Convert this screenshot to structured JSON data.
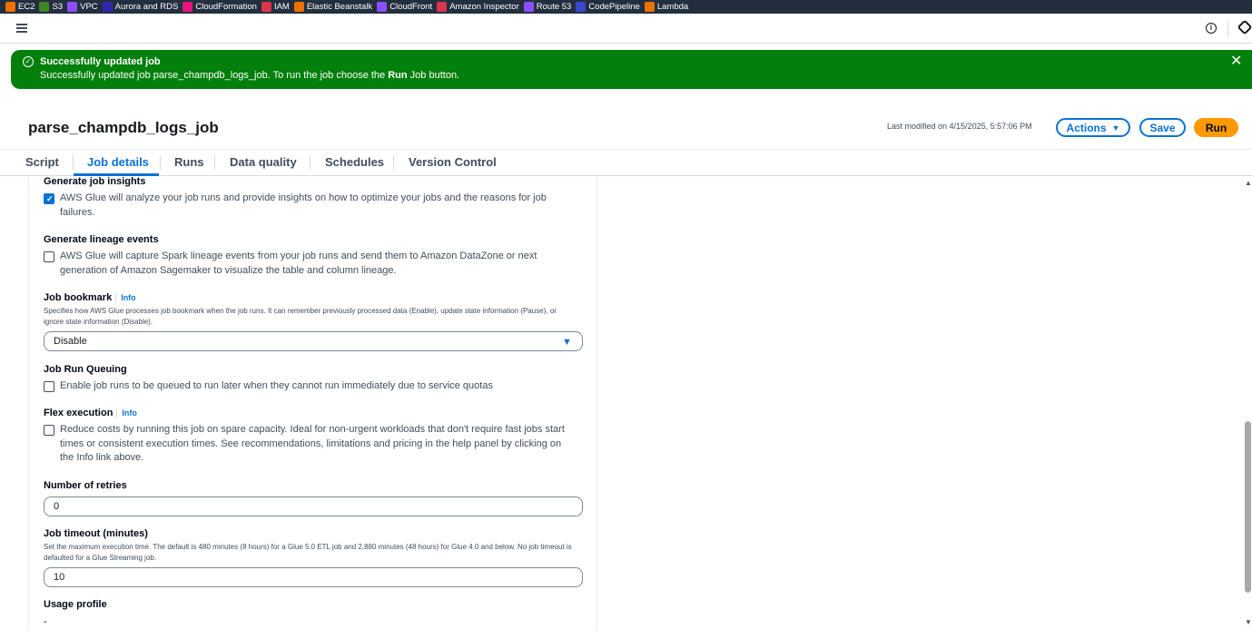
{
  "favorites": [
    {
      "label": "EC2",
      "color": "#ed7100"
    },
    {
      "label": "S3",
      "color": "#3f8624"
    },
    {
      "label": "VPC",
      "color": "#8c4fff"
    },
    {
      "label": "Aurora and RDS",
      "color": "#2e27ad"
    },
    {
      "label": "CloudFormation",
      "color": "#e7157b"
    },
    {
      "label": "IAM",
      "color": "#dd344c"
    },
    {
      "label": "Elastic Beanstalk",
      "color": "#ed7100"
    },
    {
      "label": "CloudFront",
      "color": "#8c4fff"
    },
    {
      "label": "Amazon Inspector",
      "color": "#dd344c"
    },
    {
      "label": "Route 53",
      "color": "#8c4fff"
    },
    {
      "label": "CodePipeline",
      "color": "#3b48cc"
    },
    {
      "label": "Lambda",
      "color": "#ed7100"
    }
  ],
  "flash": {
    "title": "Successfully updated job",
    "message_before": "Successfully updated job parse_champdb_logs_job. To run the job choose the ",
    "message_bold": "Run",
    "message_after": " Job button.",
    "color": "#037f0c"
  },
  "header": {
    "title": "parse_champdb_logs_job",
    "last_modified": "Last modified on 4/15/2025, 5:57:06 PM",
    "actions_label": "Actions",
    "save_label": "Save",
    "run_label": "Run"
  },
  "tabs": [
    "Script",
    "Job details",
    "Runs",
    "Data quality",
    "Schedules",
    "Version Control"
  ],
  "active_tab": "Job details",
  "form": {
    "insights": {
      "label": "Generate job insights",
      "checkbox_text": "AWS Glue will analyze your job runs and provide insights on how to optimize your jobs and the reasons for job failures.",
      "checked": true
    },
    "lineage": {
      "label": "Generate lineage events",
      "checkbox_text": "AWS Glue will capture Spark lineage events from your job runs and send them to Amazon DataZone or next generation of Amazon Sagemaker to visualize the table and column lineage.",
      "checked": false
    },
    "bookmark": {
      "label": "Job bookmark",
      "info": "Info",
      "description": "Specifies how AWS Glue processes job bookmark when the job runs. It can remember previously processed data (Enable), update state information (Pause), or ignore state information (Disable).",
      "value": "Disable"
    },
    "queuing": {
      "label": "Job Run Queuing",
      "checkbox_text": "Enable job runs to be queued to run later when they cannot run immediately due to service quotas",
      "checked": false
    },
    "flex": {
      "label": "Flex execution",
      "info": "Info",
      "checkbox_text": "Reduce costs by running this job on spare capacity. Ideal for non-urgent workloads that don't require fast jobs start times or consistent execution times. See recommendations, limitations and pricing in the help panel by clicking on the Info link above.",
      "checked": false
    },
    "retries": {
      "label": "Number of retries",
      "value": "0"
    },
    "timeout": {
      "label": "Job timeout (minutes)",
      "description": "Set the maximum execution time. The default is 480 minutes (8 hours) for a Glue 5.0 ETL job and 2,880 minutes (48 hours) for Glue 4.0 and below. No job timeout is defaulted for a Glue Streaming job.",
      "value": "10"
    },
    "usage_profile": {
      "label": "Usage profile",
      "value": "-"
    }
  },
  "colors": {
    "accent": "#0972d3",
    "run_button": "#ff9900"
  }
}
